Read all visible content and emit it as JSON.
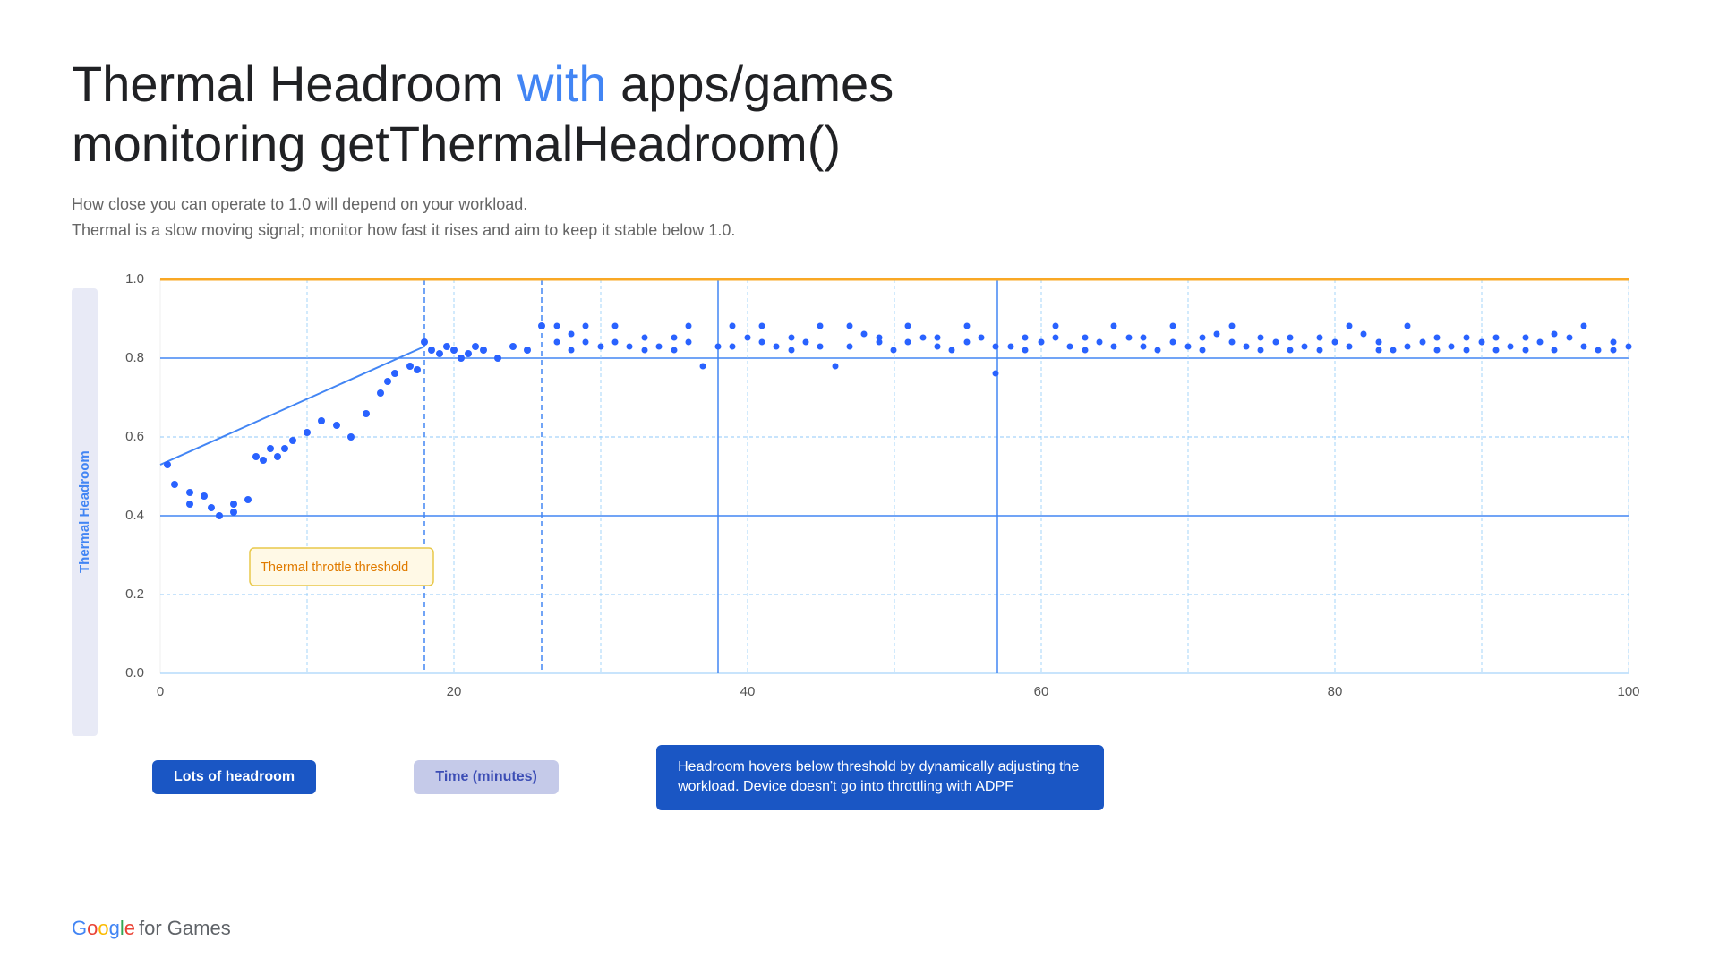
{
  "title": {
    "part1": "Thermal Headroom ",
    "highlight": "with",
    "part2": " apps/games",
    "line2": "monitoring getThermalHeadroom()"
  },
  "subtitle": {
    "line1": "How close you can operate to 1.0 will depend on your workload.",
    "line2": "Thermal is a slow moving signal; monitor how fast it rises and aim to keep it stable below 1.0."
  },
  "yAxis": {
    "label": "Thermal Headroom",
    "values": [
      "1.0",
      "0.8",
      "0.6",
      "0.4",
      "0.2",
      "0.0"
    ]
  },
  "xAxis": {
    "label": "Time (minutes)",
    "values": [
      "0",
      "20",
      "40",
      "60",
      "80",
      "100"
    ]
  },
  "legend": {
    "tooltip": "Thermal throttle threshold"
  },
  "bottomLabels": {
    "lots_headroom": "Lots of headroom",
    "time_minutes": "Time (minutes)",
    "adpf_info": "Headroom hovers below threshold by dynamically adjusting the workload. Device doesn't go into throttling with ADPF"
  },
  "googleLogo": {
    "google": "Google",
    "for_games": " for Games"
  },
  "colors": {
    "blue": "#4285F4",
    "orange": "#F4A800",
    "dark_blue": "#1a56c4",
    "light_blue": "#c5cae9",
    "dot_blue": "#2962FF",
    "grid_blue": "#90CAF9",
    "threshold_line": "#F9A825"
  }
}
